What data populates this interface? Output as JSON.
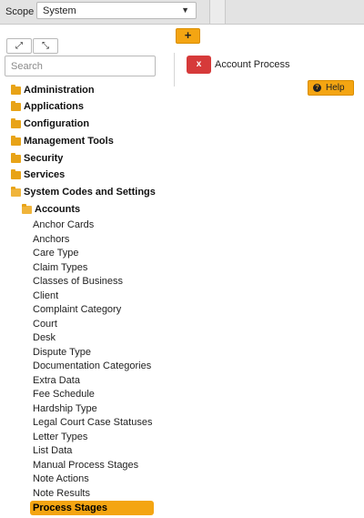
{
  "scope": {
    "label": "Scope",
    "value": "System"
  },
  "left_pane": {
    "expand_icon": "expand-arrows-icon",
    "collapse_icon": "collapse-arrows-icon",
    "search_placeholder": "Search"
  },
  "tree": {
    "folders": [
      {
        "label": "Administration"
      },
      {
        "label": "Applications"
      },
      {
        "label": "Configuration"
      },
      {
        "label": "Management Tools"
      },
      {
        "label": "Security"
      },
      {
        "label": "Services"
      },
      {
        "label": "System Codes and Settings"
      }
    ],
    "subfolder": {
      "label": "Accounts"
    },
    "leaves": [
      {
        "label": "Anchor Cards"
      },
      {
        "label": "Anchors"
      },
      {
        "label": "Care Type"
      },
      {
        "label": "Claim Types"
      },
      {
        "label": "Classes of Business"
      },
      {
        "label": "Client"
      },
      {
        "label": "Complaint Category"
      },
      {
        "label": "Court"
      },
      {
        "label": "Desk"
      },
      {
        "label": "Dispute Type"
      },
      {
        "label": "Documentation Categories"
      },
      {
        "label": "Extra Data"
      },
      {
        "label": "Fee Schedule"
      },
      {
        "label": "Hardship Type"
      },
      {
        "label": "Legal Court Case Statuses"
      },
      {
        "label": "Letter Types"
      },
      {
        "label": "List Data"
      },
      {
        "label": "Manual Process Stages"
      },
      {
        "label": "Note Actions"
      },
      {
        "label": "Note Results"
      },
      {
        "label": "Process Stages"
      }
    ],
    "selected": "Process Stages"
  },
  "right_pane": {
    "add_label": "+",
    "item": {
      "remove_label": "x",
      "label": "Account Process"
    },
    "help_label": "Help"
  },
  "colors": {
    "accent": "#f4a512",
    "remove": "#d63a3a",
    "folder": "#e8a317"
  }
}
